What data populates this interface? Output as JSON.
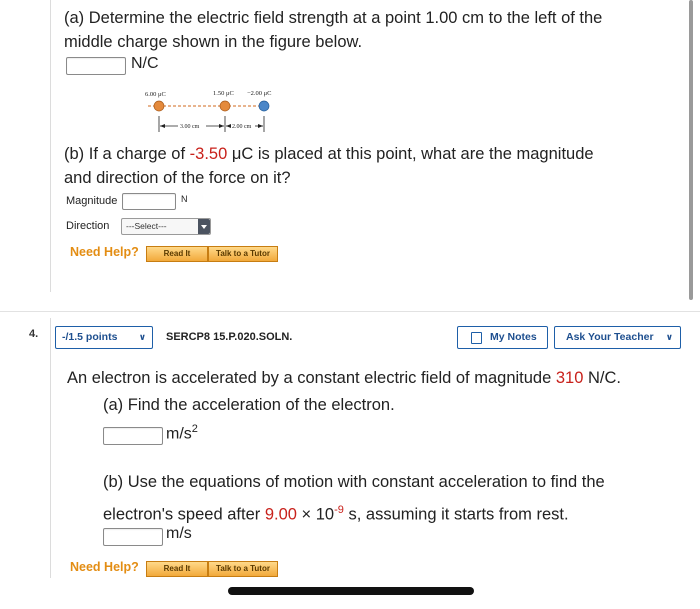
{
  "q3": {
    "part_a_line1": "(a) Determine the electric field strength at a point 1.00 cm to the left of the",
    "part_a_line2": "middle charge shown in the figure below.",
    "part_a_unit": "N/C",
    "figure": {
      "charge1": "6.00 μC",
      "charge2": "1.50 μC",
      "charge3": "−2.00 μC",
      "dist1": "3.00 cm",
      "dist2": "2.00 cm"
    },
    "part_b_line1_prefix": "(b) If a charge of ",
    "part_b_charge": "-3.50",
    "part_b_line1_suffix": " μC is placed at this point, what are the magnitude",
    "part_b_line2": "and direction of the force on it?",
    "magnitude_label": "Magnitude",
    "magnitude_unit": "N",
    "direction_label": "Direction",
    "direction_select": "---Select---",
    "need_help": "Need Help?",
    "read_it": "Read It",
    "talk_tutor": "Talk to a Tutor"
  },
  "q4": {
    "number": "4.",
    "points": "-/1.5 points",
    "code": "SERCP8 15.P.020.SOLN.",
    "my_notes": "My Notes",
    "ask_teacher": "Ask Your Teacher",
    "intro_prefix": "An electron is accelerated by a constant electric field of magnitude ",
    "intro_value": "310",
    "intro_suffix": " N/C.",
    "part_a": "(a) Find the acceleration of the electron.",
    "part_a_unit": "m/s",
    "part_a_unit_exp": "2",
    "part_b_line1": "(b) Use the equations of motion with constant acceleration to find the",
    "part_b_line2_prefix": "electron's speed after ",
    "part_b_value": "9.00",
    "part_b_times": " × 10",
    "part_b_exp": "-9",
    "part_b_line2_suffix": " s, assuming it starts from rest.",
    "part_b_unit": "m/s",
    "need_help": "Need Help?",
    "read_it": "Read It",
    "talk_tutor": "Talk to a Tutor"
  }
}
